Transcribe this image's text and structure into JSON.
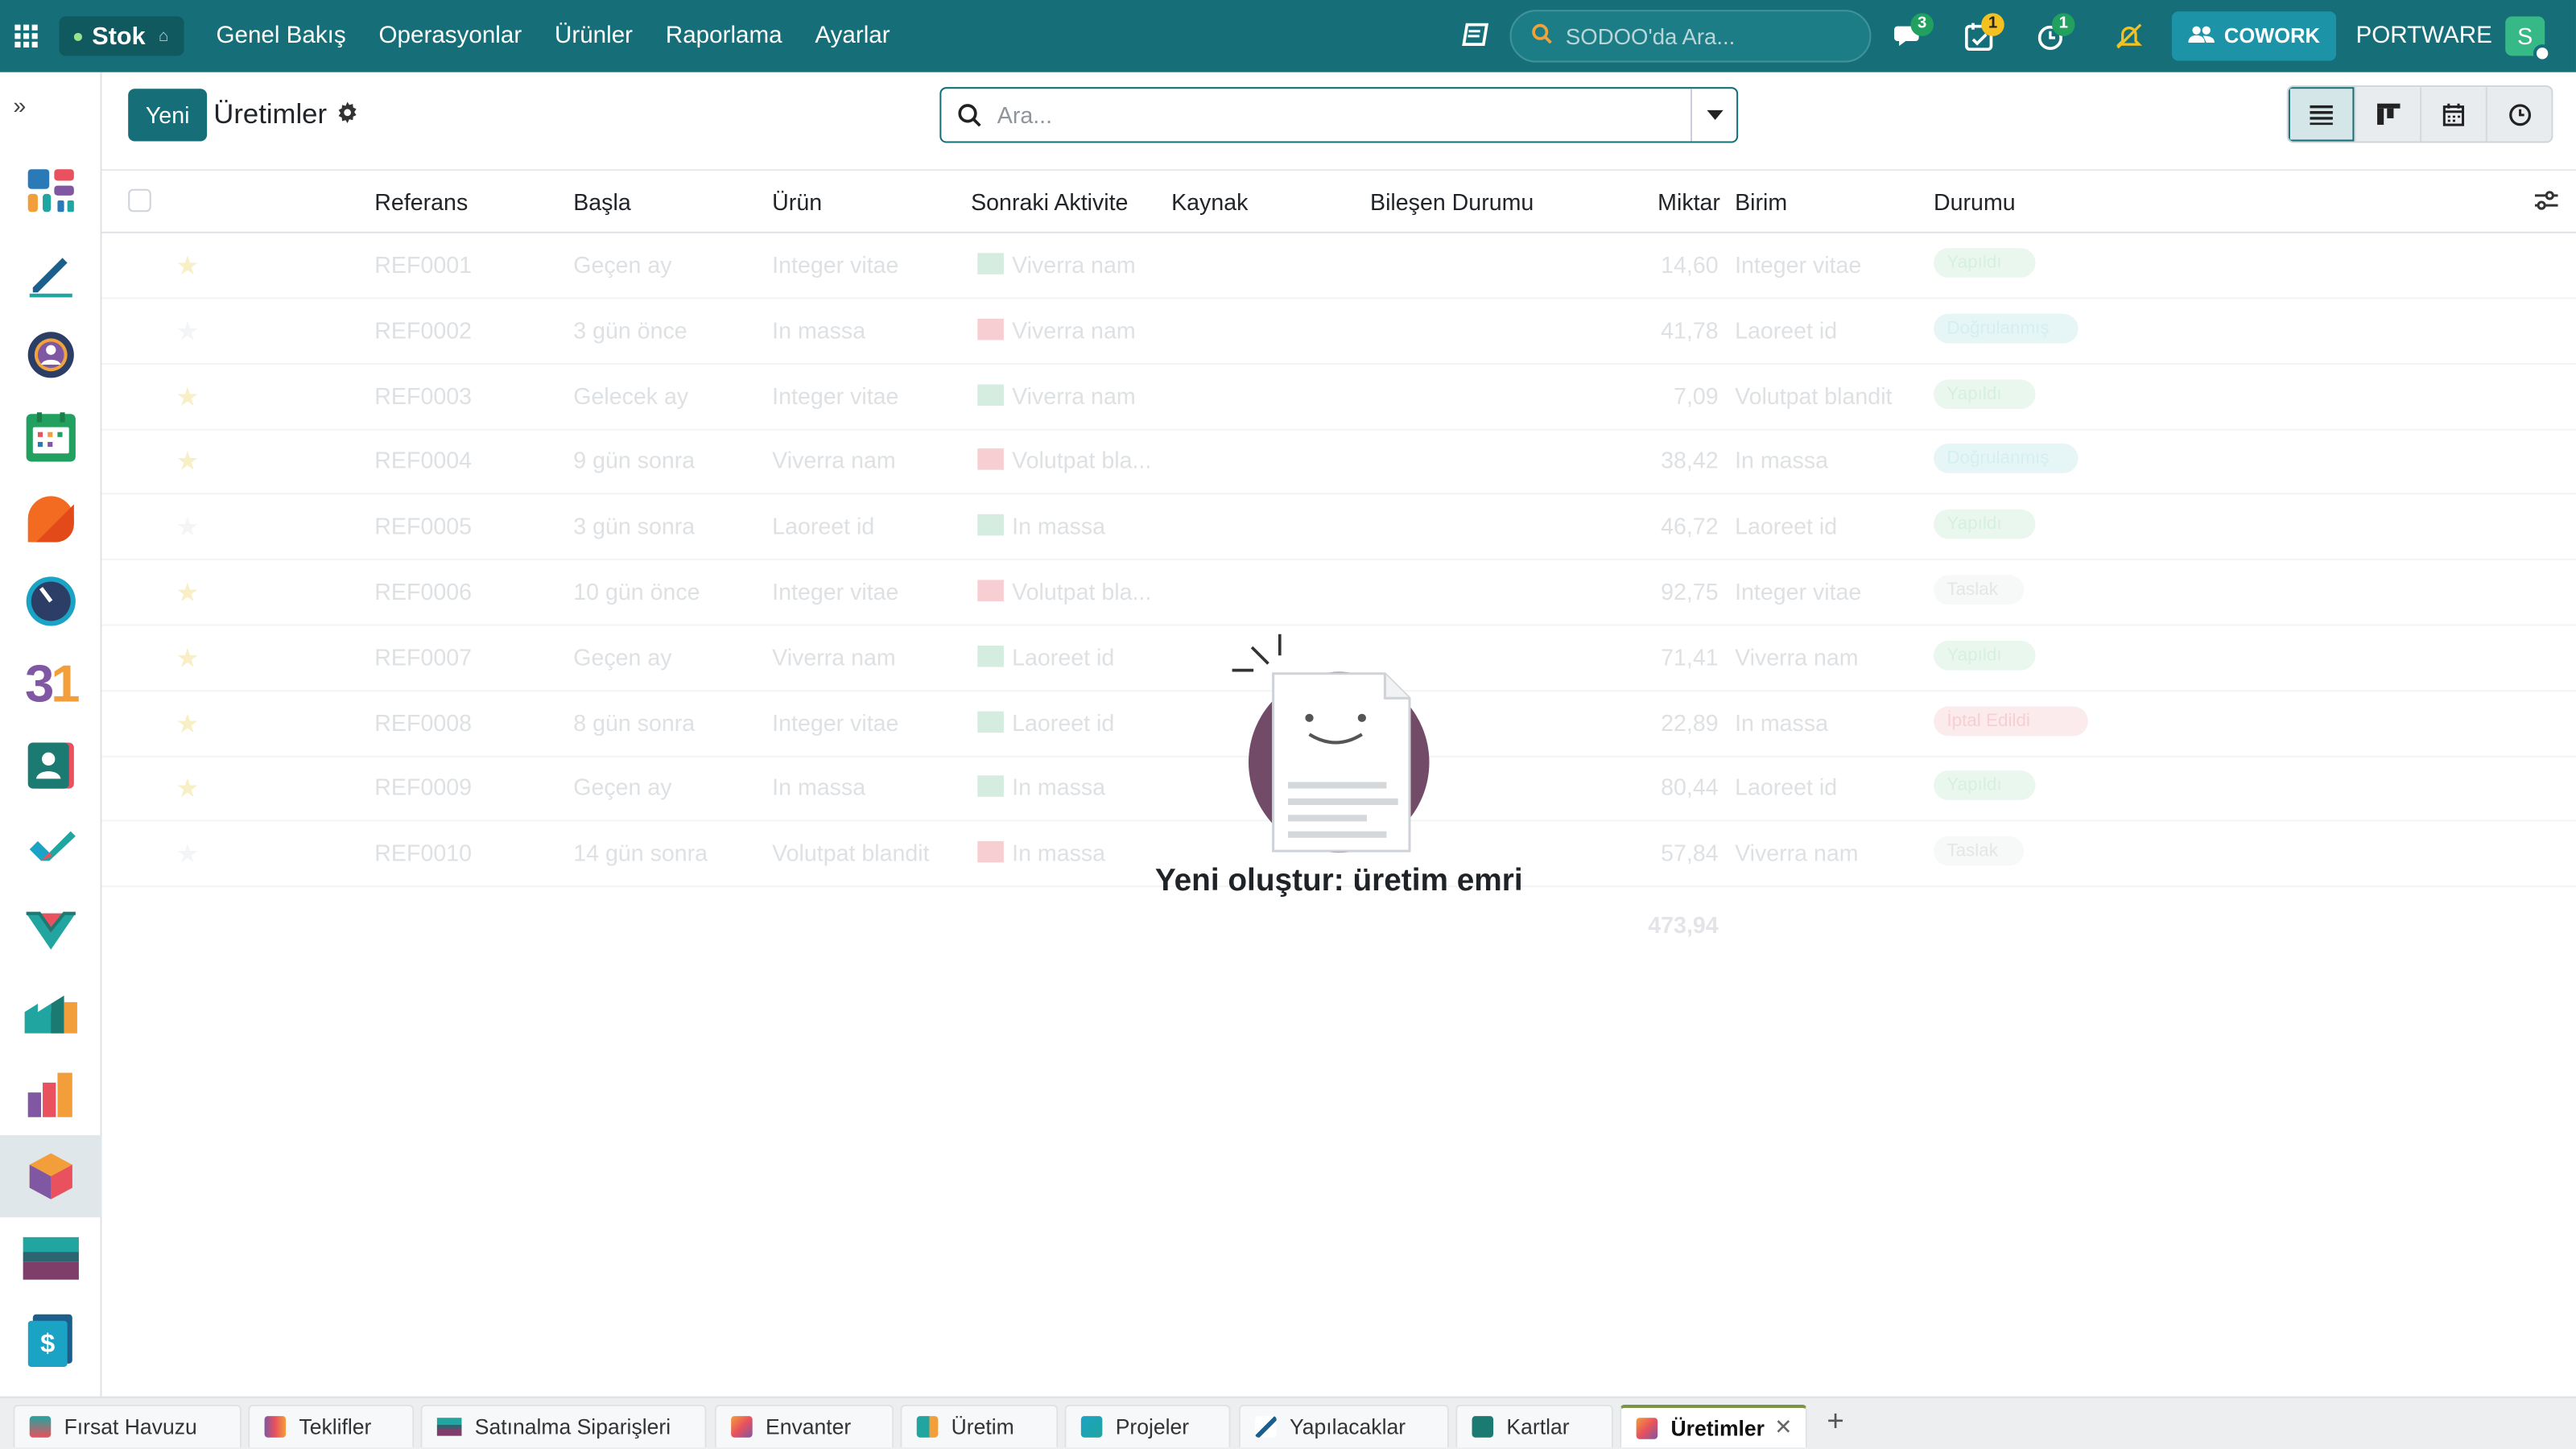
{
  "topbar": {
    "app_name": "Stok",
    "menu": [
      "Genel Bakış",
      "Operasyonlar",
      "Ürünler",
      "Raporlama",
      "Ayarlar"
    ],
    "search_placeholder": "SODOO'da Ara...",
    "badges": {
      "messages": "3",
      "activities": "1",
      "timer": "1"
    },
    "cowork_label": "COWORK",
    "company": "PORTWARE",
    "avatar_letter": "S",
    "colors": {
      "navbar": "#166f78",
      "accent": "#166f78"
    }
  },
  "control_panel": {
    "new_label": "Yeni",
    "breadcrumb": "Üretimler",
    "search_placeholder": "Ara..."
  },
  "table": {
    "headers": [
      "Referans",
      "Başla",
      "Ürün",
      "Sonraki Aktivite",
      "Kaynak",
      "Bileşen Durumu",
      "Miktar",
      "Birim",
      "Durumu"
    ],
    "rows": [
      {
        "ref": "REF0001",
        "start": "Geçen ay",
        "product": "Integer vitae",
        "activity": "Viverra nam",
        "qty": "14,60",
        "unit": "Integer vitae",
        "status": "Yapıldı",
        "starred": true
      },
      {
        "ref": "REF0002",
        "start": "3 gün önce",
        "product": "In massa",
        "activity": "Viverra nam",
        "qty": "41,78",
        "unit": "Laoreet id",
        "status": "Doğrulanmış",
        "starred": false
      },
      {
        "ref": "REF0003",
        "start": "Gelecek ay",
        "product": "Integer vitae",
        "activity": "Viverra nam",
        "qty": "7,09",
        "unit": "Volutpat blandit",
        "status": "Yapıldı",
        "starred": true
      },
      {
        "ref": "REF0004",
        "start": "9 gün sonra",
        "product": "Viverra nam",
        "activity": "Volutpat bla...",
        "qty": "38,42",
        "unit": "In massa",
        "status": "Doğrulanmış",
        "starred": true
      },
      {
        "ref": "REF0005",
        "start": "3 gün sonra",
        "product": "Laoreet id",
        "activity": "In massa",
        "qty": "46,72",
        "unit": "Laoreet id",
        "status": "Yapıldı",
        "starred": false
      },
      {
        "ref": "REF0006",
        "start": "10 gün önce",
        "product": "Integer vitae",
        "activity": "Volutpat bla...",
        "qty": "92,75",
        "unit": "Integer vitae",
        "status": "Taslak",
        "starred": true
      },
      {
        "ref": "REF0007",
        "start": "Geçen ay",
        "product": "Viverra nam",
        "activity": "Laoreet id",
        "qty": "71,41",
        "unit": "Viverra nam",
        "status": "Yapıldı",
        "starred": true
      },
      {
        "ref": "REF0008",
        "start": "8 gün sonra",
        "product": "Integer vitae",
        "activity": "Laoreet id",
        "qty": "22,89",
        "unit": "In massa",
        "status": "İptal Edildi",
        "starred": true
      },
      {
        "ref": "REF0009",
        "start": "Geçen ay",
        "product": "In massa",
        "activity": "In massa",
        "qty": "80,44",
        "unit": "Laoreet id",
        "status": "Yapıldı",
        "starred": true
      },
      {
        "ref": "REF0010",
        "start": "14 gün sonra",
        "product": "Volutpat blandit",
        "activity": "In massa",
        "qty": "57,84",
        "unit": "Viverra nam",
        "status": "Taslak",
        "starred": false
      }
    ],
    "total_qty": "473,94"
  },
  "helper": {
    "title": "Yeni oluştur: üretim emri"
  },
  "bottom_tabs": [
    {
      "label": "Fırsat Havuzu",
      "icon": "crm-icon"
    },
    {
      "label": "Teklifler",
      "icon": "sales-icon"
    },
    {
      "label": "Satınalma Siparişleri",
      "icon": "purchase-icon"
    },
    {
      "label": "Envanter",
      "icon": "inventory-icon"
    },
    {
      "label": "Üretim",
      "icon": "manufacturing-icon"
    },
    {
      "label": "Projeler",
      "icon": "project-icon"
    },
    {
      "label": "Yapılacaklar",
      "icon": "todo-icon"
    },
    {
      "label": "Kartlar",
      "icon": "contacts-icon"
    },
    {
      "label": "Üretimler",
      "icon": "inventory-icon",
      "active": true
    }
  ],
  "sidebar_apps": [
    "dashboard-icon",
    "sign-icon",
    "discuss-icon",
    "calendar-icon",
    "crm-shape-icon",
    "timer-icon",
    "calendar-31-icon",
    "contacts-icon",
    "todo-check-icon",
    "crm-handshake-icon",
    "manufacturing-icon",
    "sales-chart-icon",
    "inventory-box-icon",
    "purchase-card-icon",
    "invoice-icon"
  ]
}
